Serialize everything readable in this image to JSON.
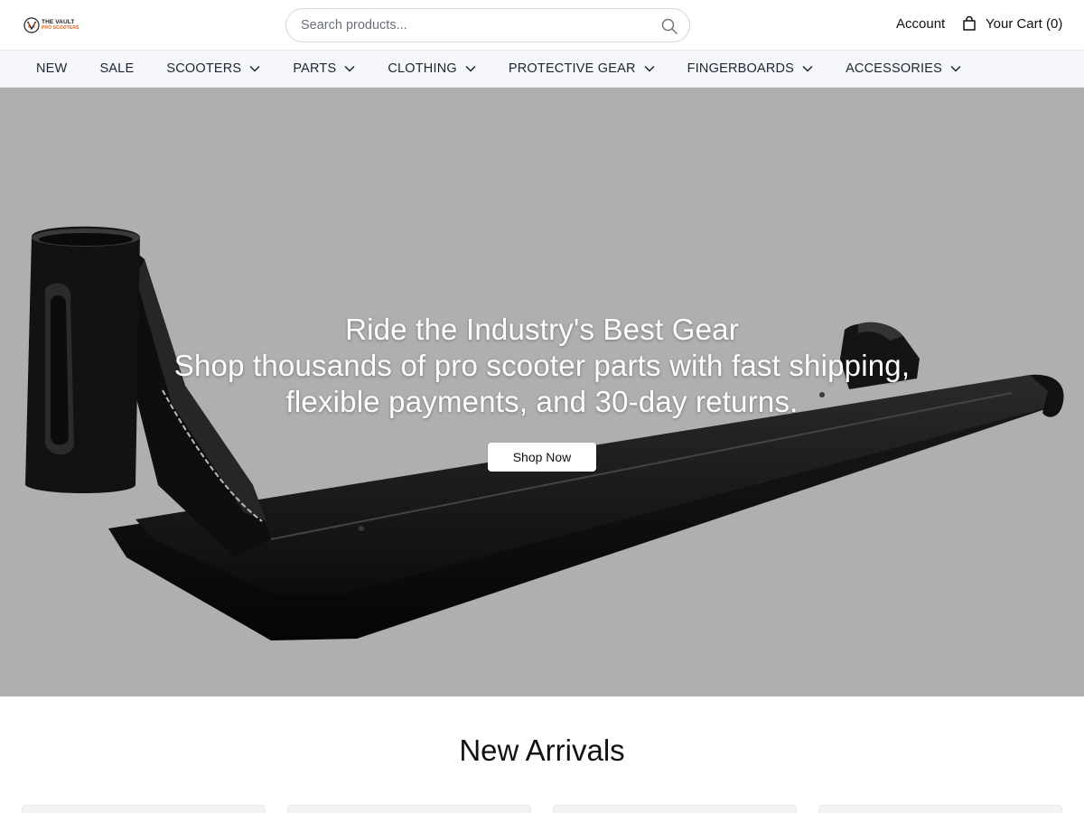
{
  "brand": {
    "logo_line1": "THE VAULT",
    "logo_line2": "PRO SCOOTERS",
    "accent": "#e0641e"
  },
  "search": {
    "placeholder": "Search products..."
  },
  "header": {
    "account_label": "Account",
    "cart_label": "Your Cart (0)"
  },
  "nav": {
    "items": [
      {
        "label": "NEW",
        "has_dropdown": false
      },
      {
        "label": "SALE",
        "has_dropdown": false
      },
      {
        "label": "SCOOTERS",
        "has_dropdown": true
      },
      {
        "label": "PARTS",
        "has_dropdown": true
      },
      {
        "label": "CLOTHING",
        "has_dropdown": true
      },
      {
        "label": "PROTECTIVE GEAR",
        "has_dropdown": true
      },
      {
        "label": "FINGERBOARDS",
        "has_dropdown": true
      },
      {
        "label": "ACCESSORIES",
        "has_dropdown": true
      }
    ]
  },
  "hero": {
    "title": "Ride the Industry's Best Gear",
    "subtitle_line1": "Shop thousands of pro scooter parts with fast shipping,",
    "subtitle_line2": "flexible payments, and 30-day returns.",
    "cta_label": "Shop Now",
    "background": "#afafaf"
  },
  "new_arrivals": {
    "title": "New Arrivals"
  },
  "icons": {
    "search": "search-icon",
    "cart": "shopping-bag-icon",
    "dropdown": "chevron-down-icon"
  }
}
